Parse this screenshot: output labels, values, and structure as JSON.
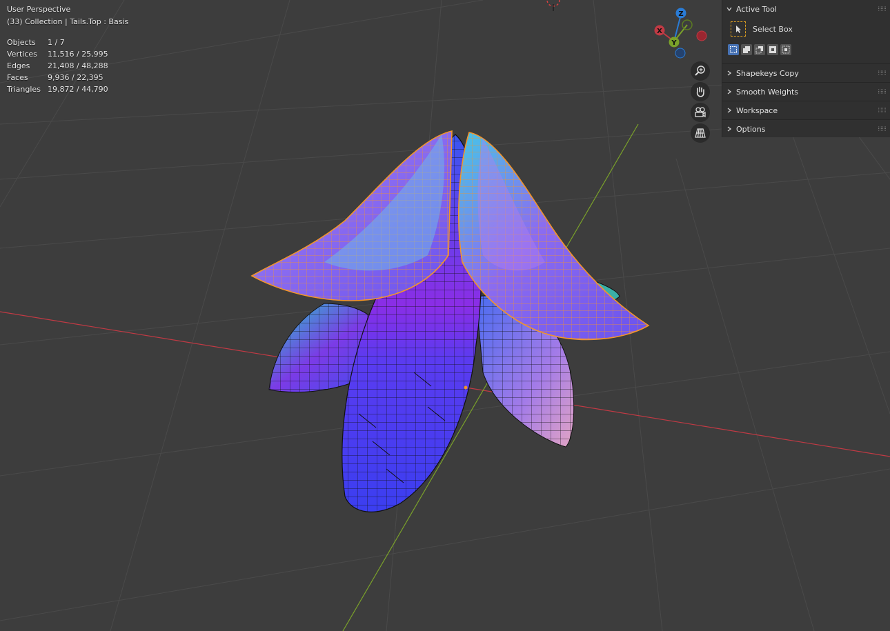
{
  "viewport": {
    "view_name": "User Perspective",
    "collection_line": "(33) Collection | Tails.Top : Basis",
    "stats": [
      {
        "label": "Objects",
        "value": "1 / 7"
      },
      {
        "label": "Vertices",
        "value": "11,516 / 25,995"
      },
      {
        "label": "Edges",
        "value": "21,408 / 48,288"
      },
      {
        "label": "Faces",
        "value": "9,936 / 22,395"
      },
      {
        "label": "Triangles",
        "value": "19,872 / 44,790"
      }
    ],
    "gizmo": {
      "x": "X",
      "y": "Y",
      "z": "Z"
    },
    "nav_buttons": [
      "zoom-icon",
      "hand-pan-icon",
      "camera-icon",
      "grid-ortho-icon"
    ]
  },
  "sidebar": {
    "active_tool": {
      "title": "Active Tool",
      "tool_label": "Select Box"
    },
    "sections": [
      {
        "label": "Shapekeys Copy"
      },
      {
        "label": "Smooth Weights"
      },
      {
        "label": "Workspace"
      },
      {
        "label": "Options"
      }
    ]
  },
  "colors": {
    "background": "#3d3d3d",
    "grid": "#4a4a4a",
    "x_axis": "#c13a44",
    "y_axis": "#7aa12a",
    "z_axis": "#2a7cd6",
    "selection": "#f2952b",
    "panel": "#303030",
    "accent": "#4772b3"
  }
}
